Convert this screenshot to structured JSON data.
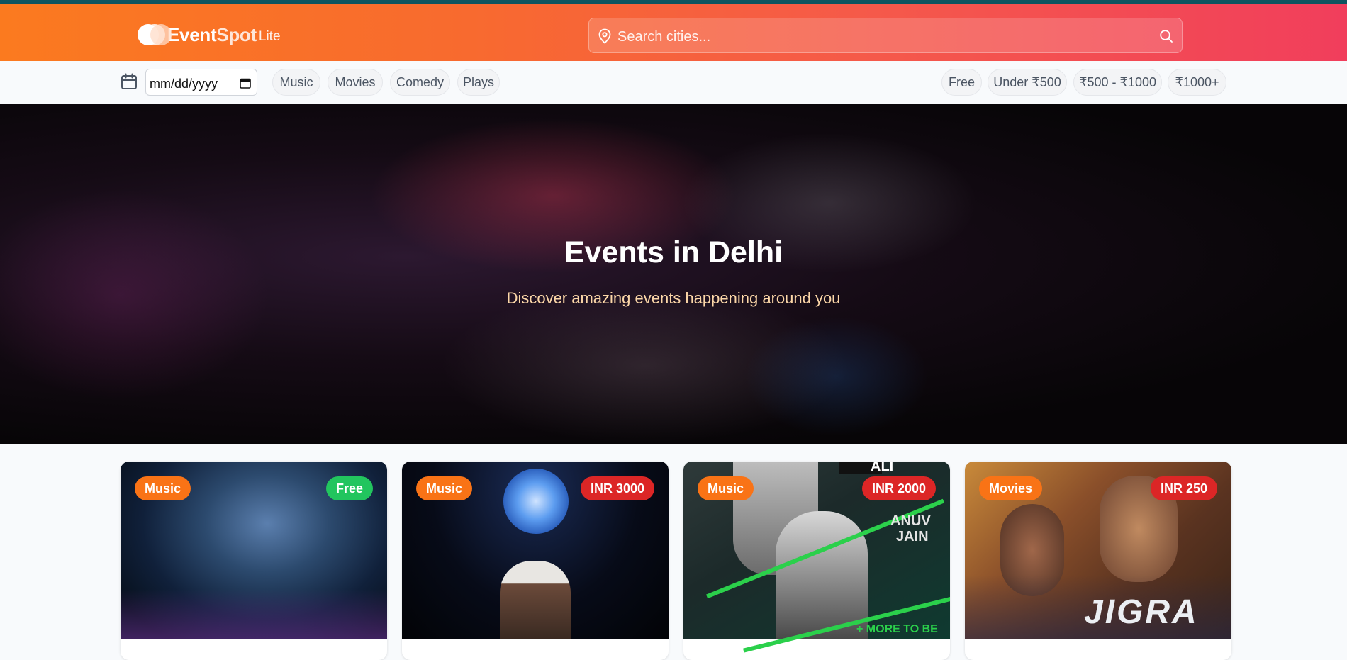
{
  "brand": {
    "name_main": "Event",
    "name_accent": "Spot",
    "name_suffix": "Lite"
  },
  "search": {
    "placeholder": "Search cities..."
  },
  "filters": {
    "date_placeholder": "mm/dd/yyyy",
    "categories": [
      {
        "label": "Music"
      },
      {
        "label": "Movies"
      },
      {
        "label": "Comedy"
      },
      {
        "label": "Plays"
      }
    ],
    "prices": [
      {
        "label": "Free"
      },
      {
        "label": "Under ₹500"
      },
      {
        "label": "₹500 - ₹1000"
      },
      {
        "label": "₹1000+"
      }
    ]
  },
  "hero": {
    "title": "Events in Delhi",
    "subtitle": "Discover amazing events happening around you"
  },
  "events": [
    {
      "category": "Music",
      "price": "Free"
    },
    {
      "category": "Music",
      "price": "INR 3000"
    },
    {
      "category": "Music",
      "price": "INR 2000",
      "poster_text": [
        "ALI",
        "ANUV",
        "JAIN",
        "+ MORE TO BE"
      ]
    },
    {
      "category": "Movies",
      "price": "INR 250",
      "poster_text": [
        "JIGRA"
      ]
    }
  ],
  "colors": {
    "header_start": "#fb7a1f",
    "header_end": "#f13e5c",
    "category_badge": "#f97316",
    "price_badge": "#dc2626",
    "free_badge": "#22c55e",
    "hero_subtitle": "#fcd7a8"
  },
  "icons": {
    "search_location": "map-pin-icon",
    "search_submit": "search-icon",
    "date": "calendar-icon",
    "date_picker": "calendar-small-icon"
  }
}
